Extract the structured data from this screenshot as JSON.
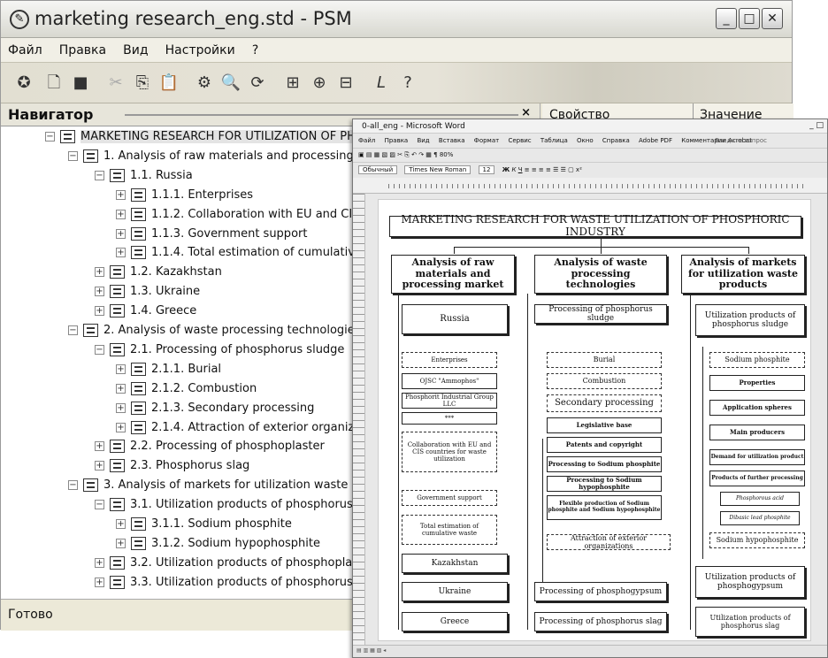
{
  "psm": {
    "title": "marketing research_eng.std - PSM",
    "menu": [
      "Файл",
      "Правка",
      "Вид",
      "Настройки",
      "?"
    ],
    "toolbar_icons": [
      "disk-star-icon",
      "new-doc-icon",
      "save-icon",
      "cut-icon",
      "copy-icon",
      "paste-icon",
      "properties-icon",
      "find-icon",
      "refresh-icon",
      "tree-add-icon",
      "tree-add-child-icon",
      "tree-remove-icon",
      "font-icon",
      "help-icon"
    ],
    "navigator": {
      "title": "Навигатор",
      "close": "×"
    },
    "properties": {
      "col_property": "Свойство",
      "col_value": "Значение"
    },
    "tree": [
      {
        "label": "MARKETING RESEARCH FOR UTILIZATION OF PHOSPH",
        "exp": "−"
      },
      {
        "label": "1. Analysis of raw materials and processing market",
        "exp": "−"
      },
      {
        "label": "1.1. Russia",
        "exp": "−"
      },
      {
        "label": "1.1.1. Enterprises",
        "exp": "+"
      },
      {
        "label": "1.1.2. Collaboration with EU and CIS cour",
        "exp": "+"
      },
      {
        "label": "1.1.3. Government support",
        "exp": "+"
      },
      {
        "label": "1.1.4. Total estimation of cumulative was",
        "exp": "+"
      },
      {
        "label": "1.2. Kazakhstan",
        "exp": "+"
      },
      {
        "label": "1.3. Ukraine",
        "exp": "+"
      },
      {
        "label": "1.4. Greece",
        "exp": "+"
      },
      {
        "label": "2. Analysis of waste processing technologies",
        "exp": "−"
      },
      {
        "label": "2.1. Processing of phosphorus sludge",
        "exp": "−"
      },
      {
        "label": "2.1.1. Burial",
        "exp": "+"
      },
      {
        "label": "2.1.2. Combustion",
        "exp": "+"
      },
      {
        "label": "2.1.3. Secondary processing",
        "exp": "+"
      },
      {
        "label": "2.1.4. Attraction of exterior organization:",
        "exp": "+"
      },
      {
        "label": "2.2. Processing of phosphoplaster",
        "exp": "+"
      },
      {
        "label": "2.3. Phosphorus slag",
        "exp": "+"
      },
      {
        "label": "3. Analysis of markets for utilization waste products",
        "exp": "−"
      },
      {
        "label": "3.1. Utilization products of phosphorus sludge",
        "exp": "−"
      },
      {
        "label": "3.1.1. Sodium phosphite",
        "exp": "+"
      },
      {
        "label": "3.1.2. Sodium hypophosphite",
        "exp": "+"
      },
      {
        "label": "3.2. Utilization products of phosphoplaster",
        "exp": "+"
      },
      {
        "label": "3.3. Utilization products of phosphorus slag",
        "exp": "+"
      }
    ],
    "status": "Готово"
  },
  "word": {
    "title": "0-all_eng - Microsoft Word",
    "menu": [
      "Файл",
      "Правка",
      "Вид",
      "Вставка",
      "Формат",
      "Сервис",
      "Таблица",
      "Окно",
      "Справка",
      "Adobe PDF",
      "Комментарии Acrobat"
    ],
    "help_box": "Введите вопрос",
    "zoom": "80%",
    "style": "Обычный",
    "font": "Times New Roman",
    "size": "12",
    "diagram": {
      "title": "MARKETING RESEARCH FOR WASTE UTILIZATION OF PHOSPHORIC INDUSTRY",
      "col1": {
        "header": "Analysis of raw materials and processing market",
        "russia": "Russia",
        "enterprises": "Enterprises",
        "ammophos": "OJSC \"Ammophos\"",
        "phosphorit": "Phosphorit Industrial Group LLC",
        "dots": "***",
        "collab": "Collaboration with EU and CIS countries for waste utilization",
        "govt": "Government support",
        "total": "Total estimation of cumulative waste",
        "kazakhstan": "Kazakhstan",
        "ukraine": "Ukraine",
        "greece": "Greece"
      },
      "col2": {
        "header": "Analysis of waste processing technologies",
        "sludge": "Processing of phosphorus sludge",
        "burial": "Burial",
        "combustion": "Combustion",
        "secondary": "Secondary processing",
        "legislative": "Legislative base",
        "patents": "Patents and copyright",
        "to_phosphite": "Processing to Sodium phosphite",
        "to_hypo": "Processing to Sodium hypophosphite",
        "flexible": "Flexible production of Sodium phosphite and Sodium hypophosphite",
        "attraction": "Attraction of exterior organizations",
        "phosphogypsum": "Processing of phosphogypsum",
        "slag": "Processing of phosphorus slag"
      },
      "col3": {
        "header": "Analysis of markets for utilization waste products",
        "sludge_products": "Utilization products of phosphorus sludge",
        "phosphite": "Sodium phosphite",
        "properties": "Properties",
        "spheres": "Application spheres",
        "producers": "Main producers",
        "demand": "Demand for utilization product",
        "further": "Products of further processing",
        "acid": "Phosphorous acid",
        "dibasic": "Dibasic lead phosphite",
        "hypo": "Sodium hypophosphite",
        "gypsum_products": "Utilization products of phosphogypsum",
        "slag_products": "Utilization products of phosphorus slag"
      }
    }
  }
}
